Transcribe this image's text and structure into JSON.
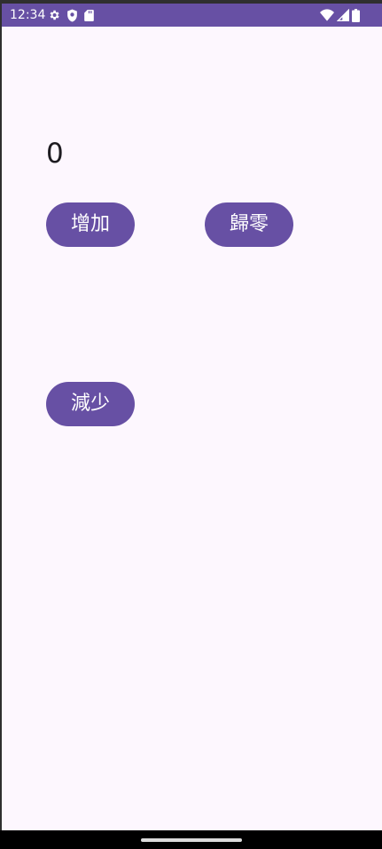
{
  "status_bar": {
    "time": "12:34",
    "left_icons": [
      "settings-icon",
      "shield-icon",
      "sd-card-icon"
    ],
    "right_icons": [
      "wifi-icon",
      "cellular-signal-icon",
      "battery-icon"
    ],
    "color": "#6750a4"
  },
  "counter": {
    "value": "0"
  },
  "buttons": {
    "increase_label": "增加",
    "reset_label": "歸零",
    "decrease_label": "減少",
    "color": "#6750a4"
  },
  "theme": {
    "background": "#fdf7fe",
    "text": "#1d1b20"
  }
}
